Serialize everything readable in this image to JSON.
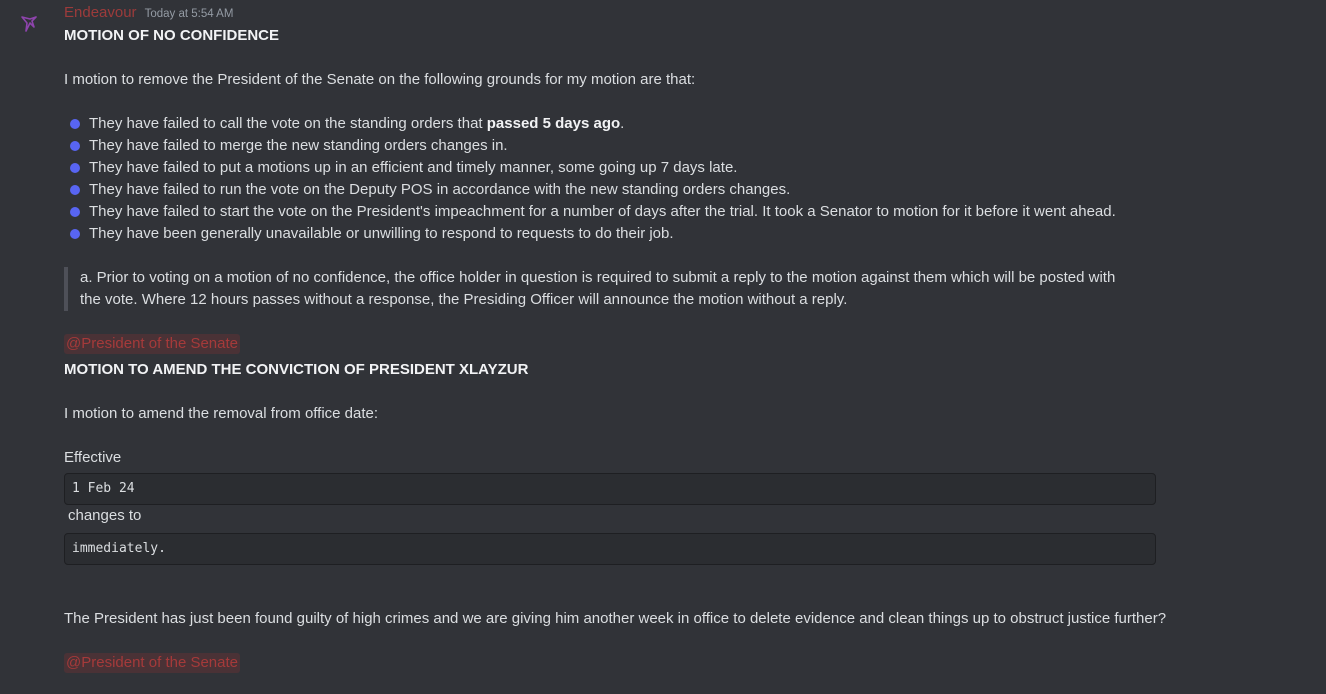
{
  "message": {
    "username": "Endeavour",
    "timestamp": "Today at 5:54 AM",
    "avatar_icon": "bird-icon",
    "accent_color": "#9c3b3b",
    "bullet_color": "#5865f2"
  },
  "motion1": {
    "title": "MOTION OF NO CONFIDENCE",
    "intro": "I motion to remove the President of the Senate on the following grounds for my motion are that:",
    "bullets": [
      {
        "pre": "They have failed to call the vote on the standing orders that ",
        "bold": "passed 5 days ago",
        "post": "."
      },
      {
        "pre": "They have failed to merge the new standing orders changes in.",
        "bold": "",
        "post": ""
      },
      {
        "pre": "They have failed to put a motions up in an efficient and timely manner, some going up 7 days late.",
        "bold": "",
        "post": ""
      },
      {
        "pre": "They have failed to run the vote on the Deputy POS in accordance with the new standing orders changes.",
        "bold": "",
        "post": ""
      },
      {
        "pre": "They have failed to start the vote on the President's impeachment for a number of days after the trial. It took a Senator to motion for it before it went ahead.",
        "bold": "",
        "post": ""
      },
      {
        "pre": "They have been generally unavailable or unwilling to respond to requests to do their job.",
        "bold": "",
        "post": ""
      }
    ],
    "quote_line1": "a. Prior to voting on a motion of no confidence, the office holder in question is required to submit a reply to the motion against them which will be posted with",
    "quote_line2": "the vote. Where 12 hours passes without a response, the Presiding Officer will announce the motion without a reply.",
    "mention": "@President of the Senate"
  },
  "motion2": {
    "title": "MOTION TO AMEND THE CONVICTION OF PRESIDENT XLAYZUR",
    "intro": "I motion to amend the removal from office date:",
    "effective_label": "Effective",
    "code1": "1 Feb 24",
    "changes_to": "changes to",
    "code2": "immediately.",
    "closing": "The President has just been found guilty of high crimes and we are giving him another week in office to delete evidence and clean things up to obstruct justice further?",
    "mention": "@President of the Senate"
  }
}
